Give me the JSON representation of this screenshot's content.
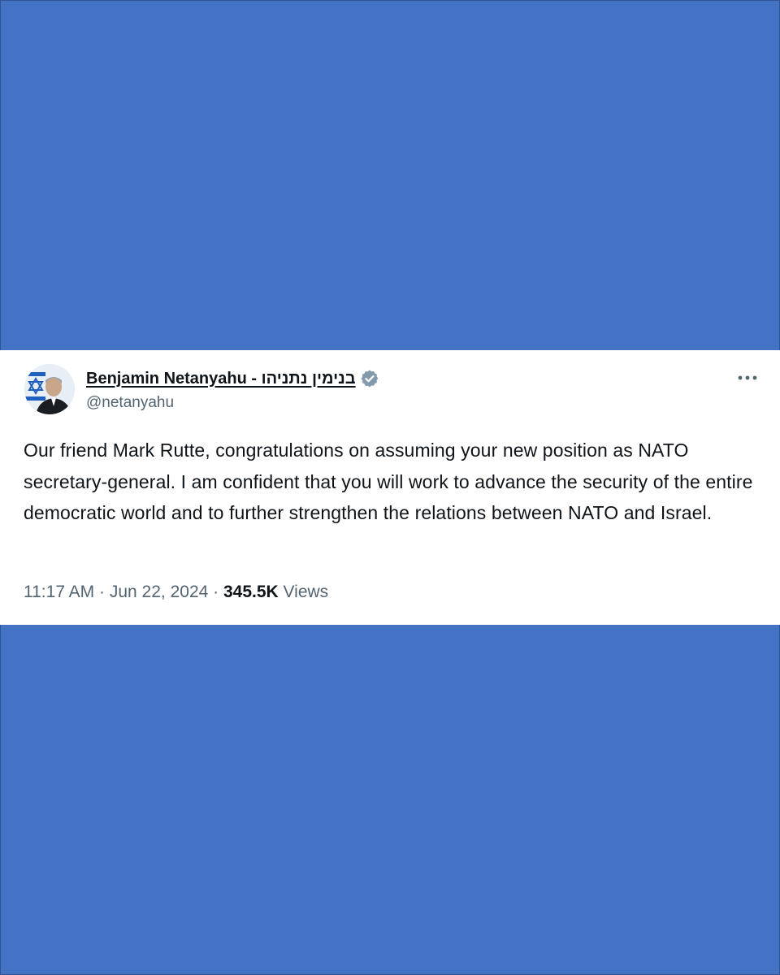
{
  "background_color": "#4472c4",
  "tweet": {
    "author": {
      "display_name": "Benjamin Netanyahu - בנימין נתניהו",
      "handle": "@netanyahu",
      "verified": true,
      "verified_badge_color": "#829aab",
      "avatar_icon": "profile-photo"
    },
    "more_icon": "ellipsis-icon",
    "text": "Our friend Mark Rutte, congratulations on assuming your new position as NATO secretary-general. I am confident that you will work to advance the security of the entire democratic world and to further strengthen the relations between NATO and Israel.",
    "time": "11:17 AM",
    "separator": "·",
    "date": "Jun 22, 2024",
    "views_count": "345.5K",
    "views_label": "Views"
  }
}
